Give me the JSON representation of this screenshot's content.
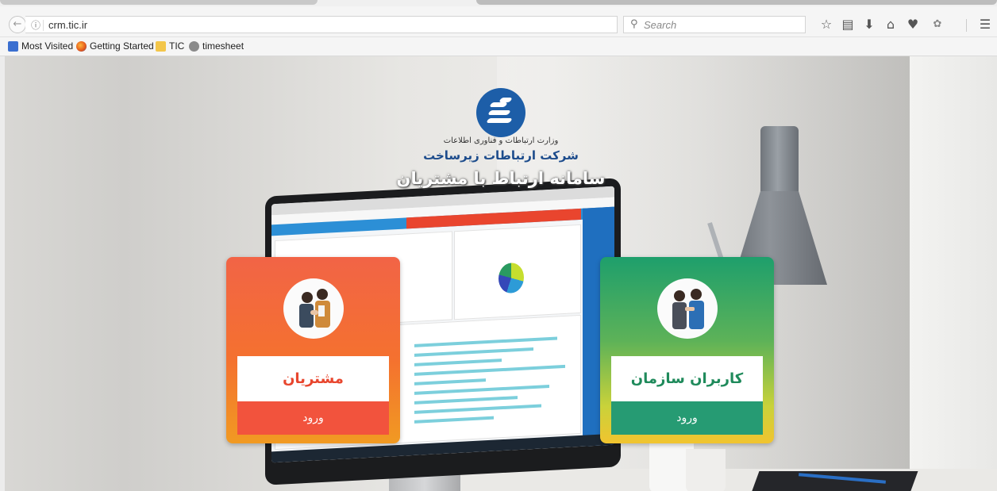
{
  "browser": {
    "url": "crm.tic.ir",
    "search_placeholder": "Search",
    "icons": [
      "back-icon",
      "info-icon",
      "reload-icon",
      "search-icon",
      "bookmark-star-icon",
      "reading-list-icon",
      "download-icon",
      "home-icon",
      "pocket-icon",
      "extension-icon",
      "menu-icon"
    ]
  },
  "bookmarks": [
    {
      "label": "Most Visited"
    },
    {
      "label": "Getting Started"
    },
    {
      "label": "TIC"
    },
    {
      "label": "timesheet"
    }
  ],
  "header": {
    "ministry": "وزارت ارتباطات و فناوری اطلاعات",
    "company": "شرکت ارتباطات زیرساخت",
    "system_name": "سامانه ارتباط با مشتریان"
  },
  "cards": {
    "customers": {
      "title": "مشتریان",
      "login": "ورود",
      "color": "#f2533d"
    },
    "staff": {
      "title": "کاربران سازمان",
      "login": "ورود",
      "color": "#269b73"
    }
  }
}
